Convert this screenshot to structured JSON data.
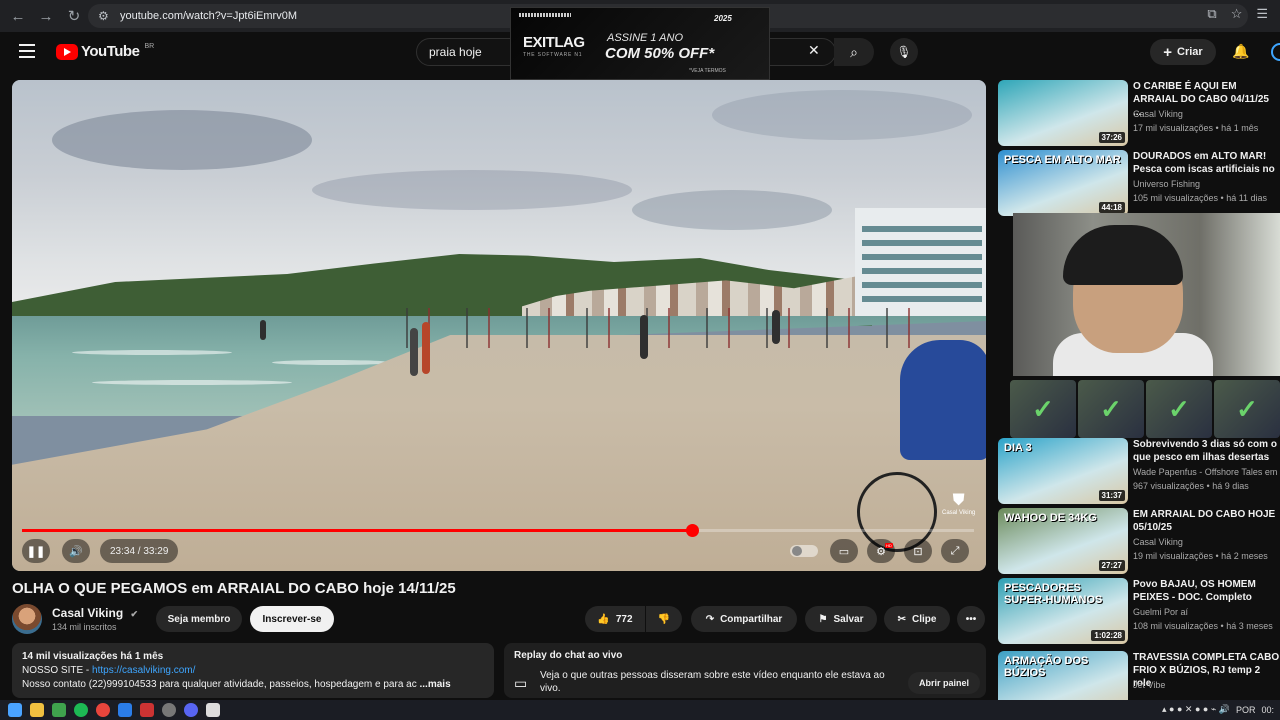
{
  "browser": {
    "url": "youtube.com/watch?v=Jpt6iEmrv0M"
  },
  "header": {
    "logo_text": "YouTube",
    "country_code": "BR",
    "search_value": "praia hoje",
    "create_label": "Criar"
  },
  "ad": {
    "brand": "EXITLAG",
    "brand_sub": "THE SOFTWARE N1",
    "line1": "ASSINE 1 ANO",
    "line2": "COM 50% OFF*",
    "footnote": "*VEJA TERMOS",
    "year_tag": "2025"
  },
  "player": {
    "time_display": "23:34 / 33:29",
    "progress_fraction": 0.704,
    "watermark": "Casal Viking"
  },
  "video": {
    "title": "OLHA O QUE PEGAMOS em ARRAIAL DO CABO hoje 14/11/25",
    "channel_name": "Casal Viking",
    "subscribers": "134 mil inscritos",
    "member_label": "Seja membro",
    "subscribe_label": "Inscrever-se",
    "likes": "772",
    "share_label": "Compartilhar",
    "save_label": "Salvar",
    "clip_label": "Clipe"
  },
  "description": {
    "stats": "14 mil visualizações  há 1 mês",
    "site_label": "NOSSO SITE - ",
    "site_link": "https://casalviking.com/",
    "contact": "Nosso contato (22)999104533 para qualquer atividade, passeios, hospedagem e para ac",
    "more_label": "...mais"
  },
  "chat_replay": {
    "title": "Replay do chat ao vivo",
    "text": "Veja o que outras pessoas disseram sobre este vídeo enquanto ele estava ao vivo.",
    "button_label": "Abrir painel"
  },
  "sidebar": {
    "items": [
      {
        "title": "O CARIBE É AQUI EM ARRAIAL DO CABO 04/11/25 ...",
        "channel": "Casal Viking",
        "meta": "17 mil visualizações • há 1 mês",
        "duration": "37:26",
        "thumb_color": "#2fa6b8"
      },
      {
        "title": "DOURADOS em ALTO MAR! Pesca com iscas artificiais no",
        "channel": "Universo Fishing",
        "meta": "105 mil visualizações • há 11 dias",
        "duration": "44:18",
        "thumb_color": "#2f8fd0",
        "thumb_text": "PESCA EM ALTO MAR"
      },
      {
        "title": "Sobrevivendo 3 dias só com o que pesco em ilhas desertas",
        "channel": "Wade Papenfus - Offshore Tales em",
        "meta": "967 visualizações • há 9 dias",
        "duration": "31:37",
        "thumb_color": "#2ba3c9",
        "thumb_text": "DIA 3"
      },
      {
        "title": "EM ARRAIAL DO CABO HOJE 05/10/25",
        "channel": "Casal Viking",
        "meta": "19 mil visualizações • há 2 meses",
        "duration": "27:27",
        "thumb_color": "#6b8a5a",
        "thumb_text": "WAHOO DE 34KG"
      },
      {
        "title": "Povo BAJAU, OS HOMEM PEIXES - DOC. Completo",
        "channel": "Guelmi Por aí",
        "meta": "108 mil visualizações • há 3 meses",
        "duration": "1:02:28",
        "thumb_color": "#2e9fb3",
        "thumb_text": "PESCADORES SUPER-HUMANOS"
      },
      {
        "title": "TRAVESSIA COMPLETA CABO FRIO X BÚZIOS, RJ temp 2 role",
        "channel": "Jet Vibe",
        "meta": "",
        "duration": "",
        "thumb_color": "#3c9fc4",
        "thumb_text": "ARMAÇÃO DOS BÚZIOS"
      }
    ]
  },
  "taskbar": {
    "language": "POR",
    "clock": "00:"
  }
}
